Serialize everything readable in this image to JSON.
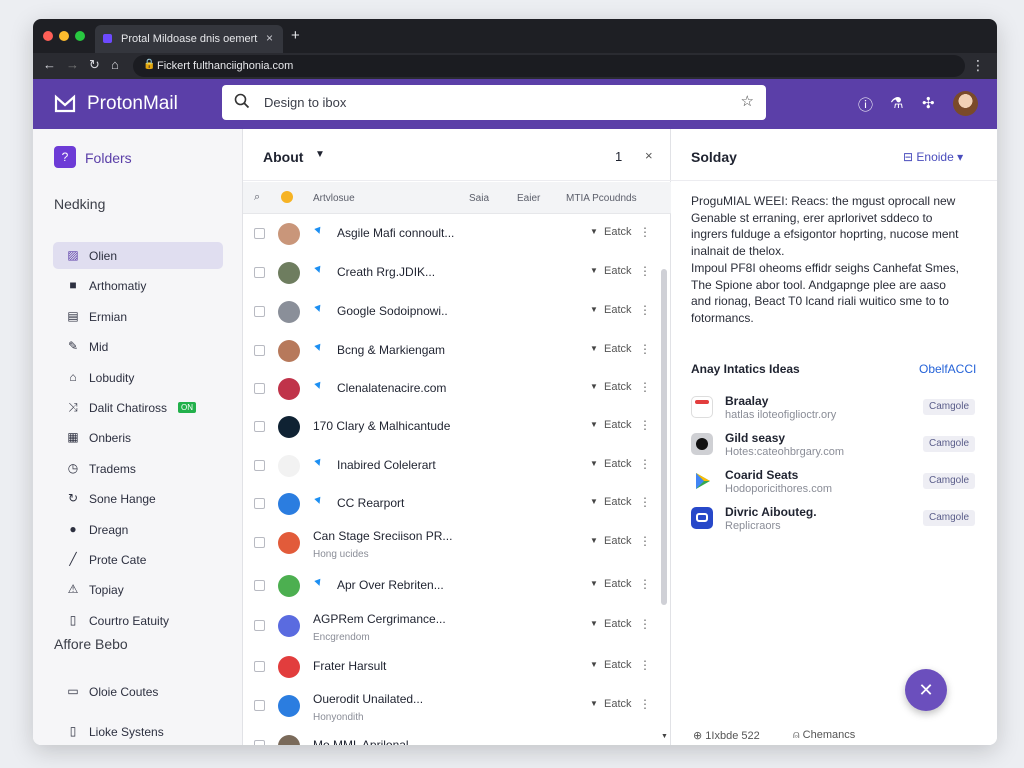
{
  "browser": {
    "tab_title": "Protal Mildoase dnis oemert",
    "tab_close": "×",
    "new_tab": "+",
    "url": "Fickert fulthanciighonia.com"
  },
  "header": {
    "brand": "ProtonMail",
    "search_placeholder": "Design to ibox"
  },
  "sidebar": {
    "folders_label": "Folders",
    "folders_icon_char": "?",
    "section1_title": "Nedking",
    "items": [
      {
        "label": "Olien",
        "icon": "folder-icon",
        "active": true
      },
      {
        "label": "Arthomatiy",
        "icon": "square-icon"
      },
      {
        "label": "Ermian",
        "icon": "inbox-icon"
      },
      {
        "label": "Mid",
        "icon": "pencil-box-icon"
      },
      {
        "label": "Lobudity",
        "icon": "home-icon"
      },
      {
        "label": "Dalit Chatiross",
        "icon": "shuffle-icon",
        "badge": "ON"
      },
      {
        "label": "Onberis",
        "icon": "grid-icon"
      },
      {
        "label": "Tradems",
        "icon": "clock-icon"
      },
      {
        "label": "Sone Hange",
        "icon": "loop-icon"
      },
      {
        "label": "Dreagn",
        "icon": "person-icon"
      },
      {
        "label": "Prote Cate",
        "icon": "pen-icon"
      },
      {
        "label": "Topiay",
        "icon": "warning-icon"
      },
      {
        "label": "Courtro Eatuity",
        "icon": "phone-icon"
      }
    ],
    "section2_title": "Affore Bebo",
    "items2": [
      {
        "label": "Oloie Coutes",
        "icon": "doc-icon"
      },
      {
        "label": "Lioke Systens",
        "icon": "clipboard-icon"
      }
    ]
  },
  "list": {
    "title": "About",
    "count": "1",
    "close": "×",
    "columns": [
      "Artvlosue",
      "Saia",
      "Eaier",
      "MTIA Pcoudnds"
    ],
    "rows": [
      {
        "subject": "Asgile Mafi connoult...",
        "label": "Eatck",
        "bird": true,
        "avatar": "#c9967a"
      },
      {
        "subject": "Creath Rrg.JDIK...",
        "label": "Eatck",
        "bird": true,
        "avatar": "#6e7d5f"
      },
      {
        "subject": "Google Sodoipnowi..",
        "label": "Eatck",
        "bird": true,
        "avatar": "#8a8f99"
      },
      {
        "subject": "Bcng & Markiengam",
        "label": "Eatck",
        "bird": true,
        "avatar": "#b7795b"
      },
      {
        "subject": "Clenalatenacire.com",
        "label": "Eatck",
        "bird": true,
        "avatar": "#c0334a"
      },
      {
        "subject": "170 Clary & Malhicantude",
        "label": "Eatck",
        "bird": false,
        "avatar": "#0f2233"
      },
      {
        "subject": "Inabired Colelerart",
        "label": "Eatck",
        "bird": true,
        "avatar": "#f2f2f2"
      },
      {
        "subject": "CC Rearport",
        "label": "Eatck",
        "bird": true,
        "avatar": "#2b7de0"
      },
      {
        "subject": "Can Stage Sreciison PR...",
        "sub": "Hong ucides",
        "label": "Eatck",
        "bird": false,
        "avatar": "#e25b3a"
      },
      {
        "subject": "Apr Over Rebriten...",
        "label": "Eatck",
        "bird": true,
        "avatar": "#4caf50"
      },
      {
        "subject": "AGPRem Cergrimance...",
        "sub": "Encgrendom",
        "label": "Eatck",
        "bird": false,
        "avatar": "#5a6be0"
      },
      {
        "subject": "Frater Harsult",
        "label": "Eatck",
        "bird": false,
        "avatar": "#e23d3d"
      },
      {
        "subject": "Ouerodit Unailated...",
        "sub": "Honyondith",
        "label": "Eatck",
        "bird": false,
        "avatar": "#2b7de0"
      },
      {
        "subject": "Mo MML Aprilonal",
        "label": "",
        "bird": false,
        "avatar": "#7a6a5a"
      }
    ]
  },
  "reading": {
    "title": "Solday",
    "encrypt_label": "Enoide",
    "body_lines": [
      "ProguMIAL WEEI: Reacs: the mgust oprocall new",
      "Genable st erraning, erer aprlorivet sddeco to",
      "ingrers fulduge a efsigontor hoprting, nucose ment",
      "inalnait de thelox.",
      "Impoul PF8I oheoms effidr seighs Canhefat Smes,",
      "The Spione abor tool. Andgapnge plee are aaso",
      "and rionag, Beact T0 lcand riali wuitico sme to to",
      "fotormancs."
    ],
    "apps_title": "Anay Intatics Ideas",
    "apps_link": "ObelfACCI",
    "apps": [
      {
        "name": "Braalay",
        "desc": "hatlas iloteofiglioctr.ory",
        "btn": "Camgole",
        "icon_color": "#ffffff"
      },
      {
        "name": "Gild seasy",
        "desc": "Hotes:cateohbrgary.com",
        "btn": "Camgole",
        "icon_color": "#222222"
      },
      {
        "name": "Coarid Seats",
        "desc": "Hodoporicithores.com",
        "btn": "Camgole",
        "icon_color": "#ffffff"
      },
      {
        "name": "Divric Aibouteg.",
        "desc": "Replicraors",
        "btn": "Camgole",
        "icon_color": "#2748c9"
      }
    ],
    "footer_left": "1Ixbde 522",
    "footer_right": "Chemancs"
  },
  "colors": {
    "brand": "#5b3fa8",
    "accent": "#6b4fbd",
    "twitter_blue": "#1d8ff2"
  }
}
